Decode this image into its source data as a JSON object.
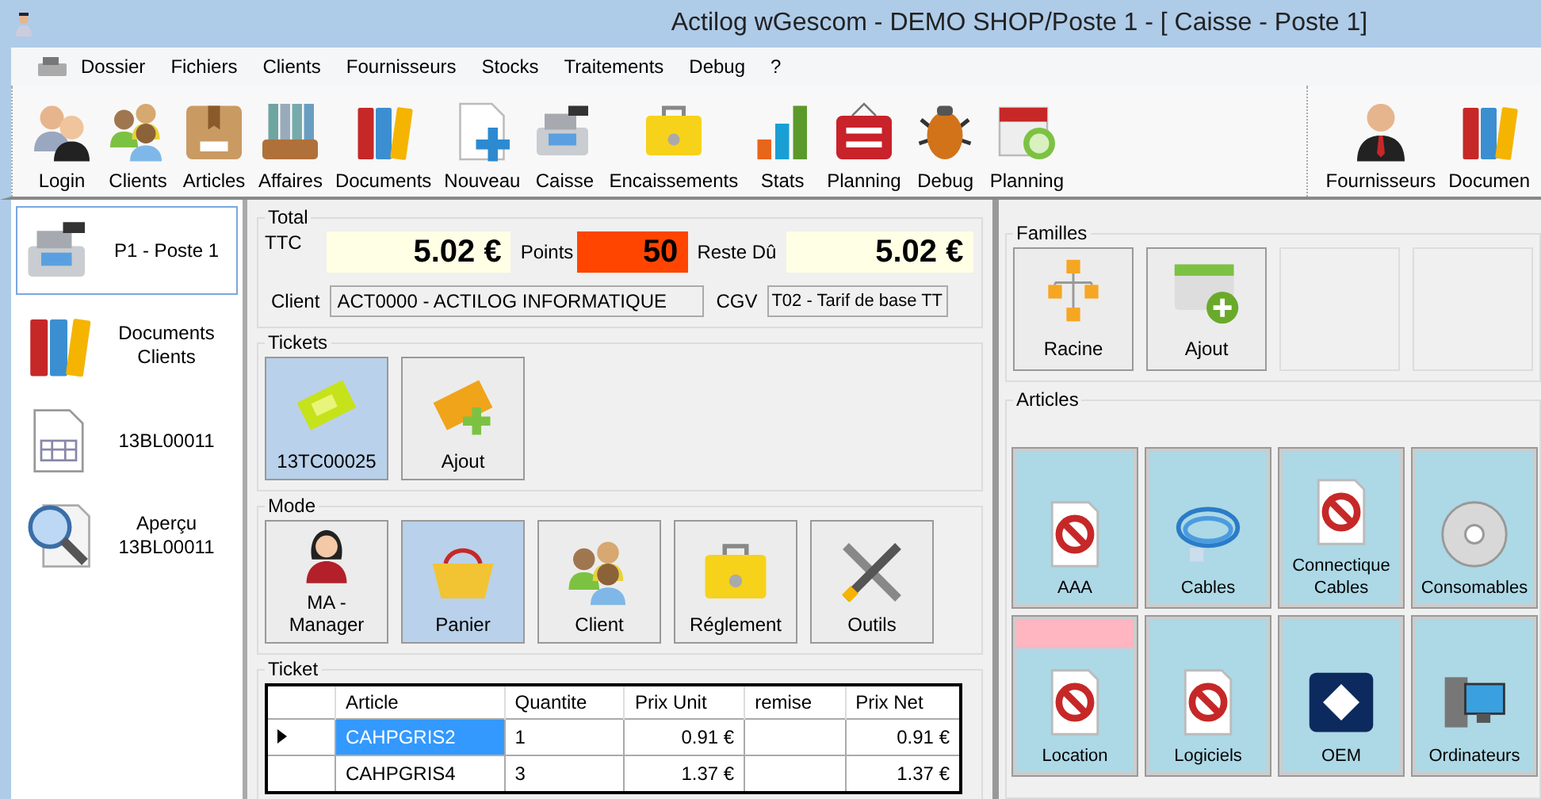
{
  "window": {
    "title": "Actilog wGescom - DEMO SHOP/Poste 1 - [ Caisse - Poste 1]"
  },
  "menu": [
    "Dossier",
    "Fichiers",
    "Clients",
    "Fournisseurs",
    "Stocks",
    "Traitements",
    "Debug",
    "?"
  ],
  "toolbar": [
    [
      {
        "label": "Login",
        "kind": "login"
      },
      {
        "label": "Clients",
        "kind": "clients"
      },
      {
        "label": "Articles",
        "kind": "box"
      },
      {
        "label": "Affaires",
        "kind": "tray"
      },
      {
        "label": "Documents",
        "kind": "binders"
      },
      {
        "label": "Nouveau",
        "kind": "newdoc"
      },
      {
        "label": "Caisse",
        "kind": "register"
      },
      {
        "label": "Encaissements",
        "kind": "toolbox"
      },
      {
        "label": "Stats",
        "kind": "stats"
      },
      {
        "label": "Planning",
        "kind": "sign"
      },
      {
        "label": "Debug",
        "kind": "bug"
      },
      {
        "label": "Planning",
        "kind": "calendar"
      }
    ],
    [
      {
        "label": "Fournisseurs",
        "kind": "supplier"
      },
      {
        "label": "Documen",
        "kind": "binders"
      }
    ]
  ],
  "sidebar": [
    {
      "label": "P1 - Poste 1",
      "kind": "register",
      "selected": true
    },
    {
      "label": "Documents Clients",
      "kind": "binders",
      "selected": false
    },
    {
      "label": "13BL00011",
      "kind": "document",
      "selected": false
    },
    {
      "label": "Aperçu 13BL00011",
      "kind": "preview",
      "selected": false
    }
  ],
  "total": {
    "group": "Total",
    "ttc_label": "TTC",
    "ttc": "5.02 €",
    "points_label": "Points",
    "points": "50",
    "reste_label": "Reste Dû",
    "reste": "5.02 €",
    "client_label": "Client",
    "client": "ACT0000 - ACTILOG INFORMATIQUE",
    "cgv_label": "CGV",
    "cgv": "T02 - Tarif de base TT"
  },
  "tickets": {
    "group": "Tickets",
    "items": [
      {
        "label": "13TC00025",
        "kind": "ticket",
        "selected": true
      },
      {
        "label": "Ajout",
        "kind": "ticketadd",
        "selected": false
      }
    ]
  },
  "mode": {
    "group": "Mode",
    "items": [
      {
        "label": "MA - Manager",
        "kind": "manager",
        "selected": false
      },
      {
        "label": "Panier",
        "kind": "basket",
        "selected": true
      },
      {
        "label": "Client",
        "kind": "clients",
        "selected": false
      },
      {
        "label": "Réglement",
        "kind": "toolbox",
        "selected": false
      },
      {
        "label": "Outils",
        "kind": "tools",
        "selected": false
      }
    ]
  },
  "ticket": {
    "group": "Ticket",
    "columns": [
      "Article",
      "Quantite",
      "Prix Unit",
      "remise",
      "Prix Net"
    ],
    "rows": [
      {
        "cells": [
          "CAHPGRIS2",
          "1",
          "0.91 €",
          "",
          "0.91 €"
        ],
        "current": true,
        "selected": true
      },
      {
        "cells": [
          "CAHPGRIS4",
          "3",
          "1.37 €",
          "",
          "1.37 €"
        ],
        "current": false,
        "selected": false
      }
    ]
  },
  "familles": {
    "group": "Familles",
    "items": [
      {
        "label": "Racine",
        "kind": "tree"
      },
      {
        "label": "Ajout",
        "kind": "folderadd"
      },
      {
        "kind": "empty"
      },
      {
        "kind": "empty"
      }
    ]
  },
  "articles": {
    "group": "Articles",
    "items": [
      {
        "label": "AAA",
        "kind": "forbidden",
        "flagged": false
      },
      {
        "label": "Cables",
        "kind": "cable",
        "flagged": false
      },
      {
        "label": "Connectique Cables",
        "kind": "forbidden",
        "flagged": false
      },
      {
        "label": "Consomables",
        "kind": "disc",
        "flagged": false
      },
      {
        "label": "Location",
        "kind": "forbidden",
        "flagged": true
      },
      {
        "label": "Logiciels",
        "kind": "forbidden",
        "flagged": false
      },
      {
        "label": "OEM",
        "kind": "oem",
        "flagged": false
      },
      {
        "label": "Ordinateurs",
        "kind": "computer",
        "flagged": false
      }
    ]
  }
}
